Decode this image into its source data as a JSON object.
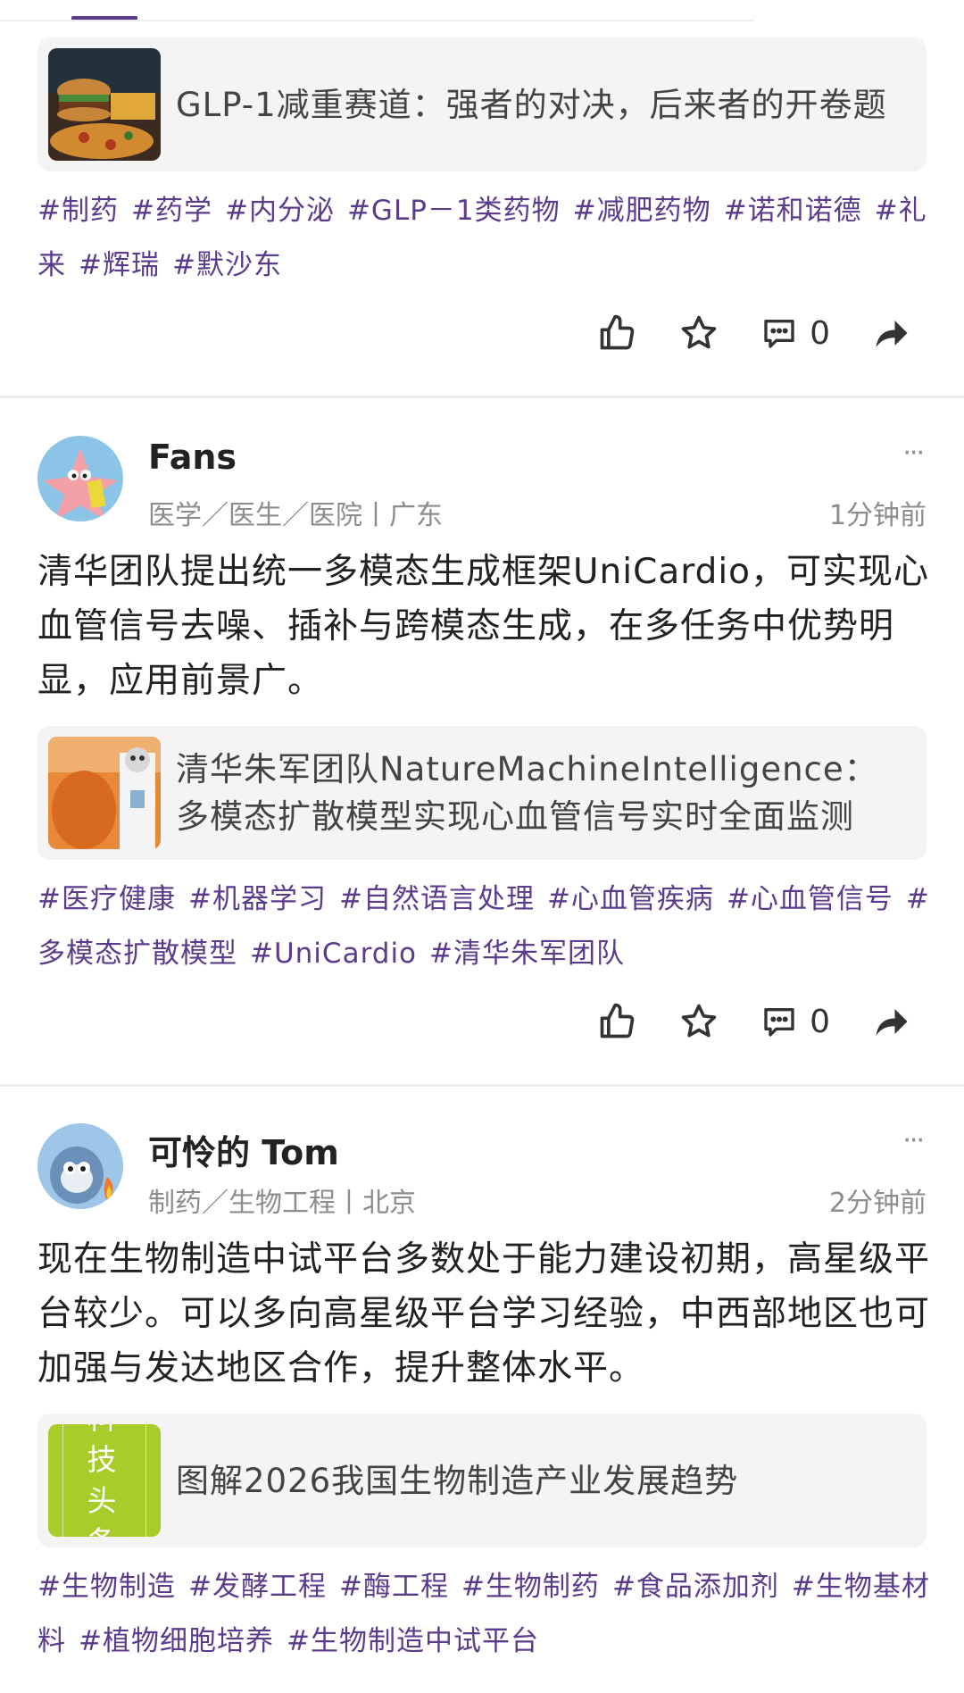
{
  "post1": {
    "card_title": "GLP-1减重赛道：强者的对决，后来者的开卷题",
    "tags": [
      "#制药",
      "#药学",
      "#内分泌",
      "#GLP－1类药物",
      "#减肥药物",
      "#诺和诺德",
      "#礼来",
      "#辉瑞",
      "#默沙东"
    ],
    "comment_count": "0"
  },
  "post2": {
    "author": "Fans",
    "meta": "医学／医生／医院丨广东",
    "time": "1分钟前",
    "content": "清华团队提出统一多模态生成框架UniCardio，可实现心血管信号去噪、插补与跨模态生成，在多任务中优势明显，应用前景广。",
    "card_title": "清华朱军团队NatureMachineIntelligence：多模态扩散模型实现心血管信号实时全面监测",
    "tags": [
      "#医疗健康",
      "#机器学习",
      "#自然语言处理",
      "#心血管疾病",
      "#心血管信号",
      "#多模态扩散模型",
      "#UniCardio",
      "#清华朱军团队"
    ],
    "comment_count": "0"
  },
  "post3": {
    "author": "可怜的 Tom",
    "meta": "制药／生物工程丨北京",
    "time": "2分钟前",
    "content": "现在生物制造中试平台多数处于能力建设初期，高星级平台较少。可以多向高星级平台学习经验，中西部地区也可加强与发达地区合作，提升整体水平。",
    "thumb_text": "科 技 头 条",
    "card_title": "图解2026我国生物制造产业发展趋势",
    "tags": [
      "#生物制造",
      "#发酵工程",
      "#酶工程",
      "#生物制药",
      "#食品添加剂",
      "#生物基材料",
      "#植物细胞培养",
      "#生物制造中试平台"
    ]
  },
  "more_label": "···",
  "colors": {
    "accent": "#5b3b8c",
    "muted": "#8c8c8c",
    "card_bg": "#f4f4f4"
  }
}
